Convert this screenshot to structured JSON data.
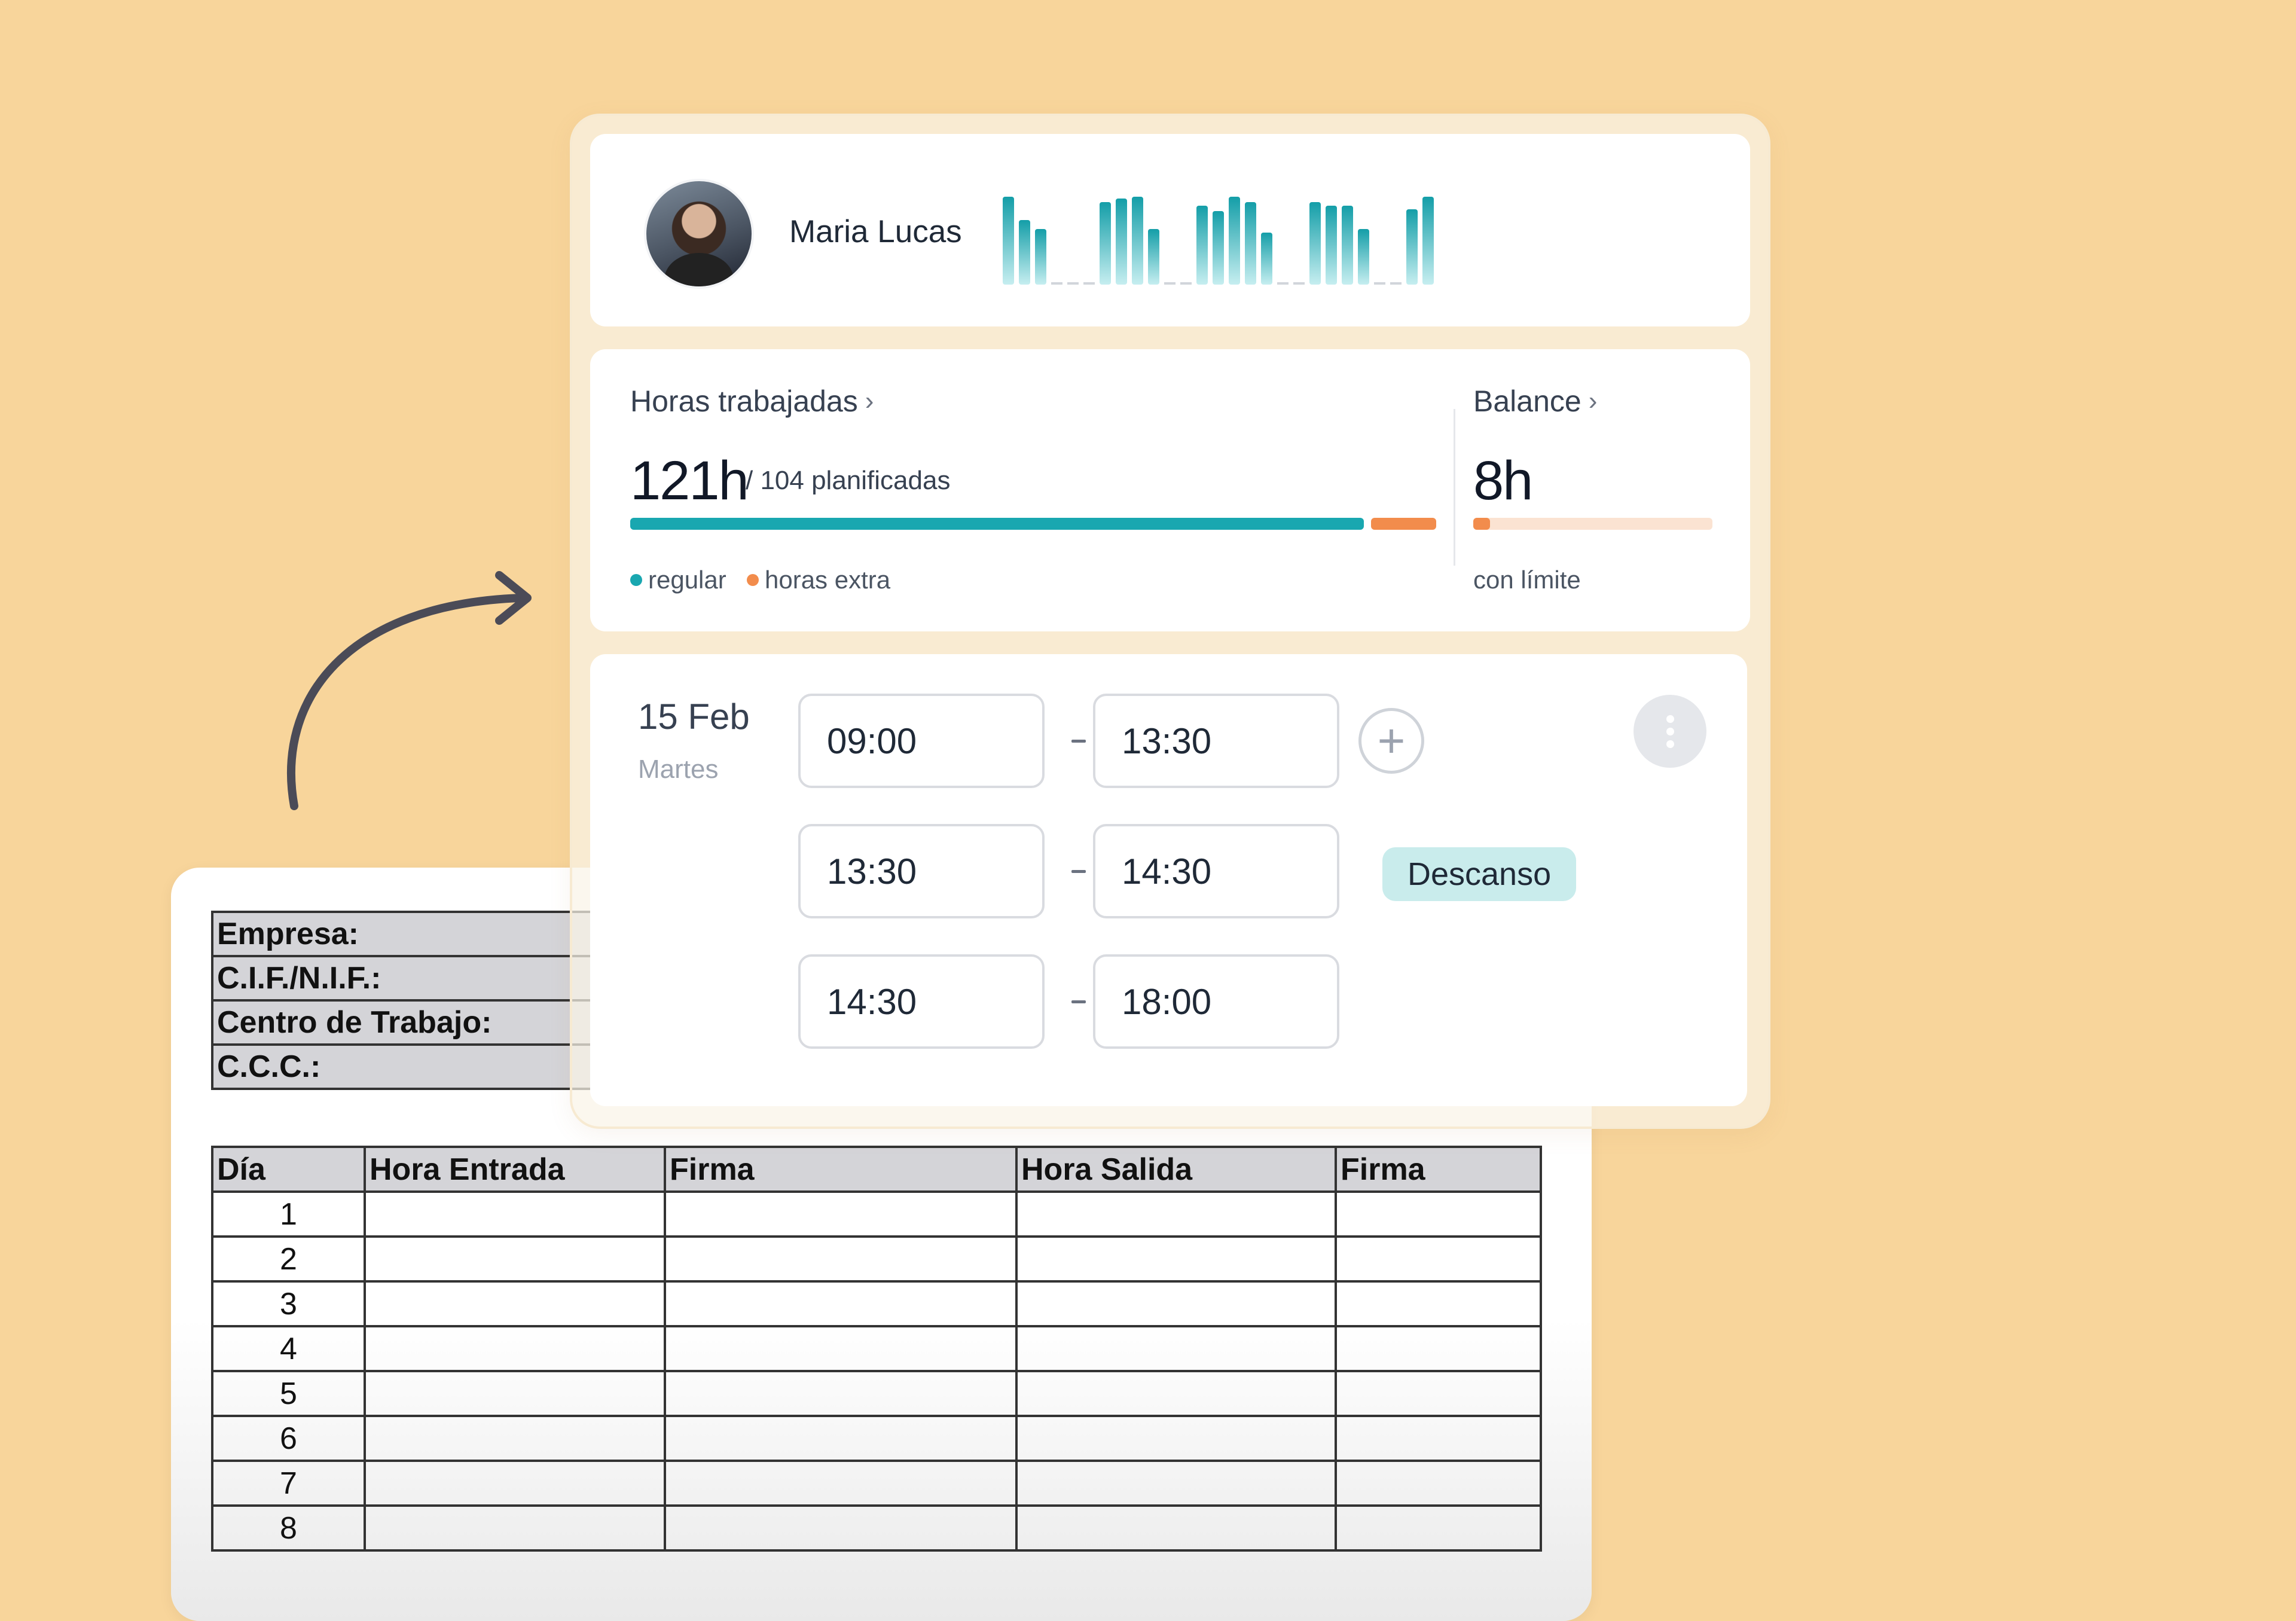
{
  "paper": {
    "info_rows": [
      "Empresa:",
      "C.I.F./N.I.F.:",
      "Centro de Trabajo:",
      "C.C.C.:"
    ],
    "columns": [
      "Día",
      "Hora Entrada",
      "Firma",
      "Hora Salida",
      "Firma"
    ],
    "days": [
      "1",
      "2",
      "3",
      "4",
      "5",
      "6",
      "7",
      "8"
    ]
  },
  "profile": {
    "name": "Maria Lucas",
    "activity_levels": [
      0.98,
      0.72,
      0.62,
      0.02,
      0.02,
      0.02,
      0.92,
      0.96,
      0.98,
      0.62,
      0.02,
      0.02,
      0.88,
      0.82,
      0.98,
      0.92,
      0.58,
      0.02,
      0.02,
      0.92,
      0.88,
      0.88,
      0.62,
      0.02,
      0.02,
      0.84,
      0.98
    ]
  },
  "worked": {
    "label": "Horas trabajadas",
    "value": "121h",
    "planned": "/ 104 planificadas",
    "regular_fraction": 0.91,
    "extra_fraction": 0.09,
    "legend_regular": "regular",
    "legend_extra": "horas extra"
  },
  "balance": {
    "label": "Balance",
    "value": "8h",
    "used_fraction": 0.07,
    "note": "con límite"
  },
  "schedule": {
    "date": "15 Feb",
    "weekday": "Martes",
    "slots": [
      {
        "start": "09:00",
        "end": "13:30"
      },
      {
        "start": "13:30",
        "end": "14:30"
      },
      {
        "start": "14:30",
        "end": "18:00"
      }
    ],
    "break_label": "Descanso",
    "add_icon": "plus-icon",
    "menu_icon": "more-vertical-icon"
  },
  "colors": {
    "teal": "#19A7B0",
    "orange": "#F28C4C",
    "orange_light": "#FBE3D2",
    "background": "#F8D59B"
  }
}
